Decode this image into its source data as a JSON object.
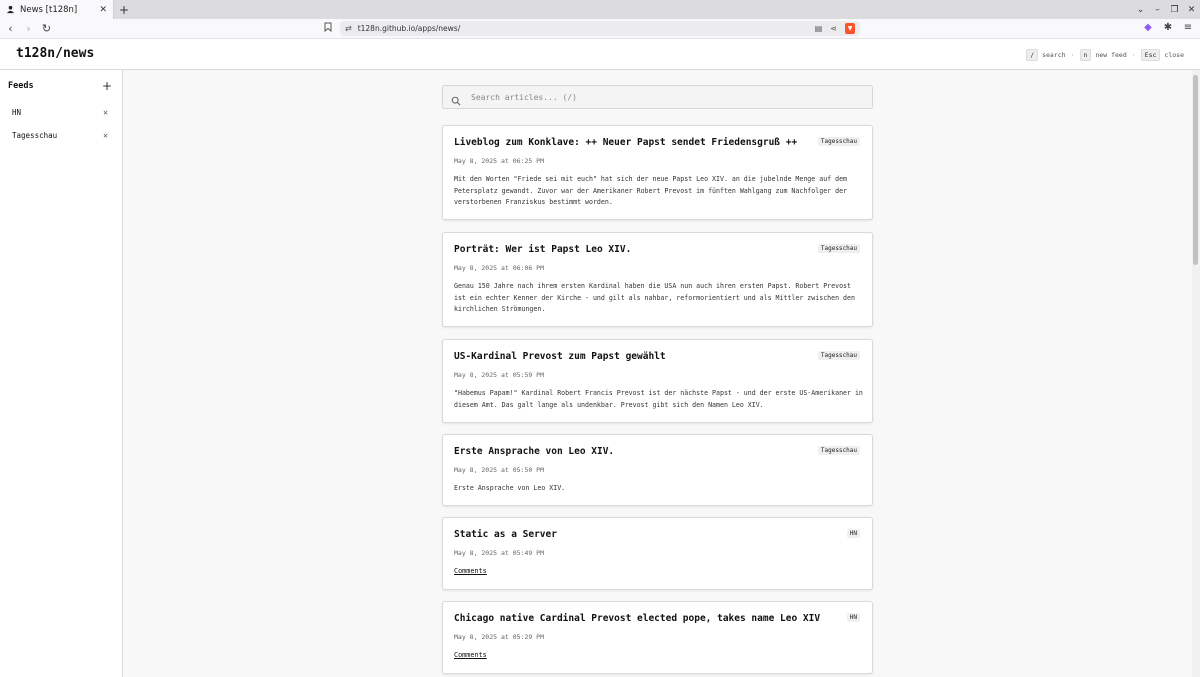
{
  "browser": {
    "tab_title": "News [t128n]",
    "url": "t128n.github.io/apps/news/"
  },
  "app": {
    "title": "t128n/news",
    "shortcuts": [
      {
        "key": "/",
        "label": "search"
      },
      {
        "key": "n",
        "label": "new feed"
      },
      {
        "key": "Esc",
        "label": "close"
      }
    ]
  },
  "sidebar": {
    "title": "Feeds",
    "feeds": [
      "HN",
      "Tagesschau"
    ]
  },
  "search": {
    "placeholder": "Search articles... (/)"
  },
  "articles": [
    {
      "title": "Liveblog zum Konklave: ++ Neuer Papst sendet Friedensgruß ++",
      "source": "Tagesschau",
      "date": "May 8, 2025 at 06:25 PM",
      "description": "Mit den Worten \"Friede sei mit euch\" hat sich der neue Papst Leo XIV. an die jubelnde Menge auf dem Petersplatz gewandt. Zuvor war der Amerikaner Robert Prevost im fünften Wahlgang zum Nachfolger der verstorbenen Franziskus bestimmt worden."
    },
    {
      "title": "Porträt: Wer ist Papst Leo XIV.",
      "source": "Tagesschau",
      "date": "May 8, 2025 at 06:06 PM",
      "description": "Genau 150 Jahre nach ihrem ersten Kardinal haben die USA nun auch ihren ersten Papst. Robert Prevost ist ein echter Kenner der Kirche - und gilt als nahbar, reformorientiert und als Mittler zwischen den kirchlichen Strömungen."
    },
    {
      "title": "US-Kardinal Prevost zum Papst gewählt",
      "source": "Tagesschau",
      "date": "May 8, 2025 at 05:59 PM",
      "description": "\"Habemus Papam!\" Kardinal Robert Francis Prevost ist der nächste Papst - und der erste US-Amerikaner in diesem Amt. Das galt lange als undenkbar. Prevost gibt sich den Namen Leo XIV."
    },
    {
      "title": "Erste Ansprache von Leo XIV.",
      "source": "Tagesschau",
      "date": "May 8, 2025 at 05:50 PM",
      "description": "Erste Ansprache von Leo XIV."
    },
    {
      "title": "Static as a Server",
      "source": "HN",
      "date": "May 8, 2025 at 05:49 PM",
      "link": "Comments"
    },
    {
      "title": "Chicago native Cardinal Prevost elected pope, takes name Leo XIV",
      "source": "HN",
      "date": "May 8, 2025 at 05:29 PM",
      "link": "Comments"
    }
  ]
}
